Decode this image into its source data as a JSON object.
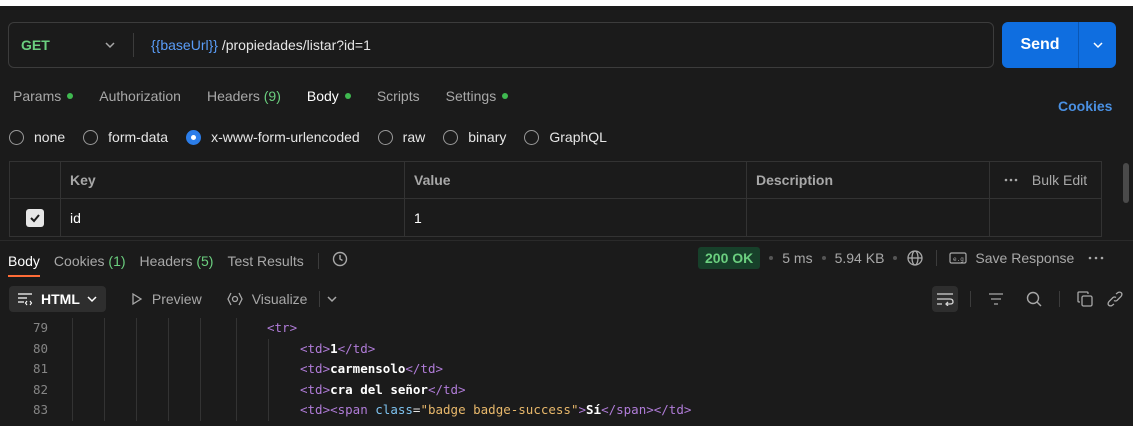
{
  "request": {
    "method": "GET",
    "url_variable": "{{baseUrl}}",
    "url_path": " /propiedades/listar?id=1",
    "send_label": "Send"
  },
  "request_tabs": [
    {
      "label": "Params",
      "dot": true
    },
    {
      "label": "Authorization",
      "dot": false
    },
    {
      "label": "Headers",
      "count": "(9)",
      "dot": false
    },
    {
      "label": "Body",
      "dot": true,
      "active": true
    },
    {
      "label": "Scripts",
      "dot": false
    },
    {
      "label": "Settings",
      "dot": true
    }
  ],
  "cookies_link": "Cookies",
  "body_types": [
    {
      "label": "none",
      "selected": false
    },
    {
      "label": "form-data",
      "selected": false
    },
    {
      "label": "x-www-form-urlencoded",
      "selected": true
    },
    {
      "label": "raw",
      "selected": false
    },
    {
      "label": "binary",
      "selected": false
    },
    {
      "label": "GraphQL",
      "selected": false
    }
  ],
  "kv_table": {
    "headers": {
      "key": "Key",
      "value": "Value",
      "description": "Description",
      "bulk_edit": "Bulk Edit"
    },
    "rows": [
      {
        "checked": true,
        "key": "id",
        "value": "1",
        "description": ""
      }
    ]
  },
  "response_tabs": {
    "body": "Body",
    "cookies": "Cookies",
    "cookies_count": "(1)",
    "headers": "Headers",
    "headers_count": "(5)",
    "test_results": "Test Results"
  },
  "response_meta": {
    "status": "200 OK",
    "time": "5 ms",
    "size": "5.94 KB",
    "save_response": "Save Response"
  },
  "viewer": {
    "format": "HTML",
    "preview": "Preview",
    "visualize": "Visualize"
  },
  "code_lines": [
    {
      "num": "79",
      "indent": 267,
      "html": "<span class='tag'>&lt;tr&gt;</span>"
    },
    {
      "num": "80",
      "indent": 300,
      "html": "<span class='tag'>&lt;td&gt;</span><span class='txt'>1</span><span class='tag'>&lt;/td&gt;</span>"
    },
    {
      "num": "81",
      "indent": 300,
      "html": "<span class='tag'>&lt;td&gt;</span><span class='txt'>carmensolo</span><span class='tag'>&lt;/td&gt;</span>"
    },
    {
      "num": "82",
      "indent": 300,
      "html": "<span class='tag'>&lt;td&gt;</span><span class='txt'>cra del señor</span><span class='tag'>&lt;/td&gt;</span>"
    },
    {
      "num": "83",
      "indent": 300,
      "html": "<span class='tag'>&lt;td&gt;&lt;span</span> <span class='attr'>class</span>=<span class='str'>\"badge badge-success\"</span><span class='tag'>&gt;</span><span class='txt'>Sí</span><span class='tag'>&lt;/span&gt;&lt;/td&gt;</span>"
    }
  ],
  "colors": {
    "accent": "#0f6ee0",
    "method_get": "#6bcf7f",
    "status_ok_bg": "#17402a",
    "active_tab_underline": "#ff6c37"
  }
}
